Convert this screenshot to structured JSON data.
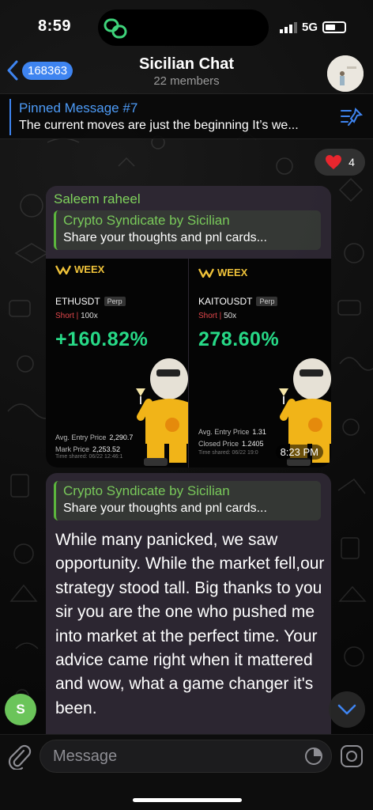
{
  "status": {
    "time": "8:59",
    "network": "5G"
  },
  "header": {
    "back_count": "168363",
    "title": "Sicilian Chat",
    "subtitle": "22 members"
  },
  "pinned": {
    "title": "Pinned Message #7",
    "text": "The current moves are just the beginning It’s we..."
  },
  "reaction": {
    "emoji": "heart-icon",
    "count": "4"
  },
  "message1": {
    "sender": "Saleem raheel",
    "reply_title": "Crypto Syndicate by Sicilian",
    "reply_text": "Share your thoughts and pnl cards...",
    "time": "8:23 PM",
    "cards": [
      {
        "brand": "WEEX",
        "pair": "ETHUSDT",
        "tag": "Perp",
        "side": "Short",
        "leverage": "100x",
        "pnl": "+160.82%",
        "line1_label": "Avg. Entry Price",
        "line1_value": "2,290.7",
        "line2_label": "Mark Price",
        "line2_value": "2,253.52",
        "shared": "Time shared: 06/22 12:46:1"
      },
      {
        "brand": "WEEX",
        "pair": "KAITOUSDT",
        "tag": "Perp",
        "side": "Short",
        "leverage": "50x",
        "pnl": "278.60%",
        "line1_label": "Avg. Entry Price",
        "line1_value": "1.31",
        "line2_label": "Closed Price",
        "line2_value": "1.2405",
        "shared": "Time shared: 06/22 19:0"
      }
    ]
  },
  "message2": {
    "reply_title": "Crypto Syndicate by Sicilian",
    "reply_text": "Share your thoughts and pnl cards...",
    "body": "While many panicked, we saw opportunity. While the market fell,our strategy stood tall. Big thanks to you sir you are the one who  pushed me into market at the perfect time. Your advice came right when it mattered and wow, what a game changer it's been."
  },
  "sender_avatar_letter": "S",
  "input": {
    "placeholder": "Message"
  },
  "colors": {
    "accent": "#3e84f0",
    "sender_green": "#7fd25c",
    "pnl_green": "#27d987",
    "short_red": "#e3474b",
    "bubble": "#2e2834"
  }
}
